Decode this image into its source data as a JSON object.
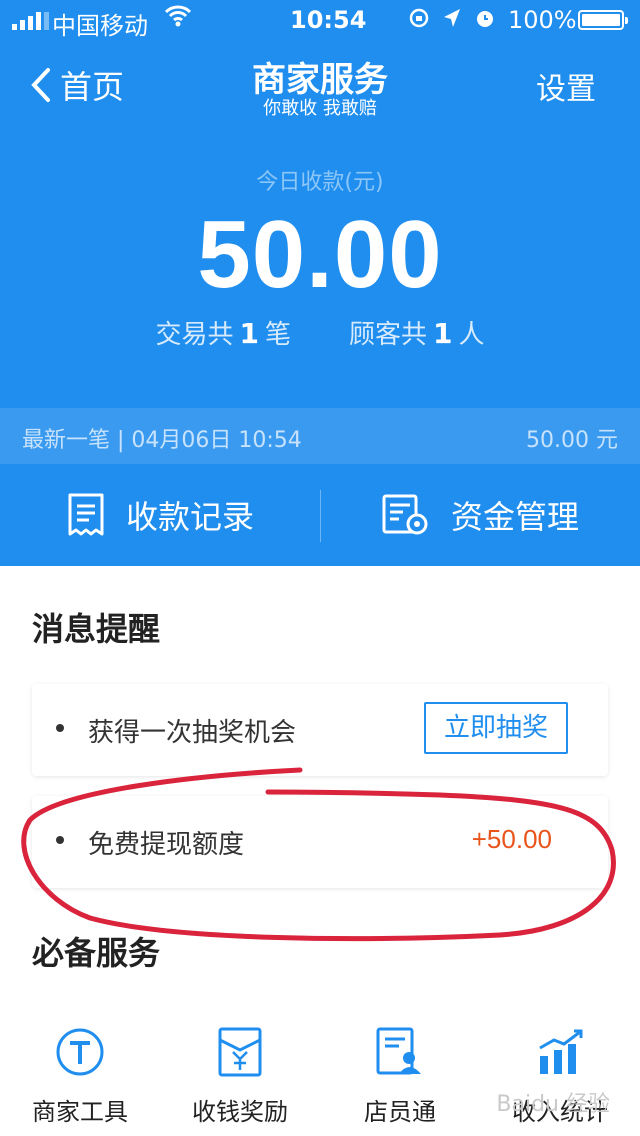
{
  "status_bar": {
    "carrier": "中国移动",
    "time": "10:54",
    "battery": "100%"
  },
  "nav": {
    "back_label": "首页",
    "title": "商家服务",
    "subtitle": "你敢收 我敢赔",
    "settings_label": "设置"
  },
  "summary": {
    "today_label": "今日收款(元)",
    "amount": "50.00",
    "trans_prefix": "交易共",
    "trans_count": "1",
    "trans_suffix": "笔",
    "cust_prefix": "顾客共",
    "cust_count": "1",
    "cust_suffix": "人"
  },
  "latest": {
    "text": "最新一笔 | 04月06日 10:54",
    "amount": "50.00 元"
  },
  "actions": {
    "records_label": "收款记录",
    "funds_label": "资金管理"
  },
  "messages": {
    "title": "消息提醒",
    "items": [
      {
        "text": "获得一次抽奖机会",
        "button": "立即抽奖"
      },
      {
        "text": "免费提现额度",
        "value": "+50.00"
      }
    ]
  },
  "services": {
    "title": "必备服务",
    "items": [
      {
        "label": "商家工具",
        "icon": "merchant-tool-icon"
      },
      {
        "label": "收钱奖励",
        "icon": "reward-icon"
      },
      {
        "label": "店员通",
        "icon": "staff-icon"
      },
      {
        "label": "收入统计",
        "icon": "stats-icon"
      }
    ]
  },
  "colors": {
    "primary": "#1f8eef",
    "accent": "#e9541a",
    "annotation": "#d9243c"
  }
}
